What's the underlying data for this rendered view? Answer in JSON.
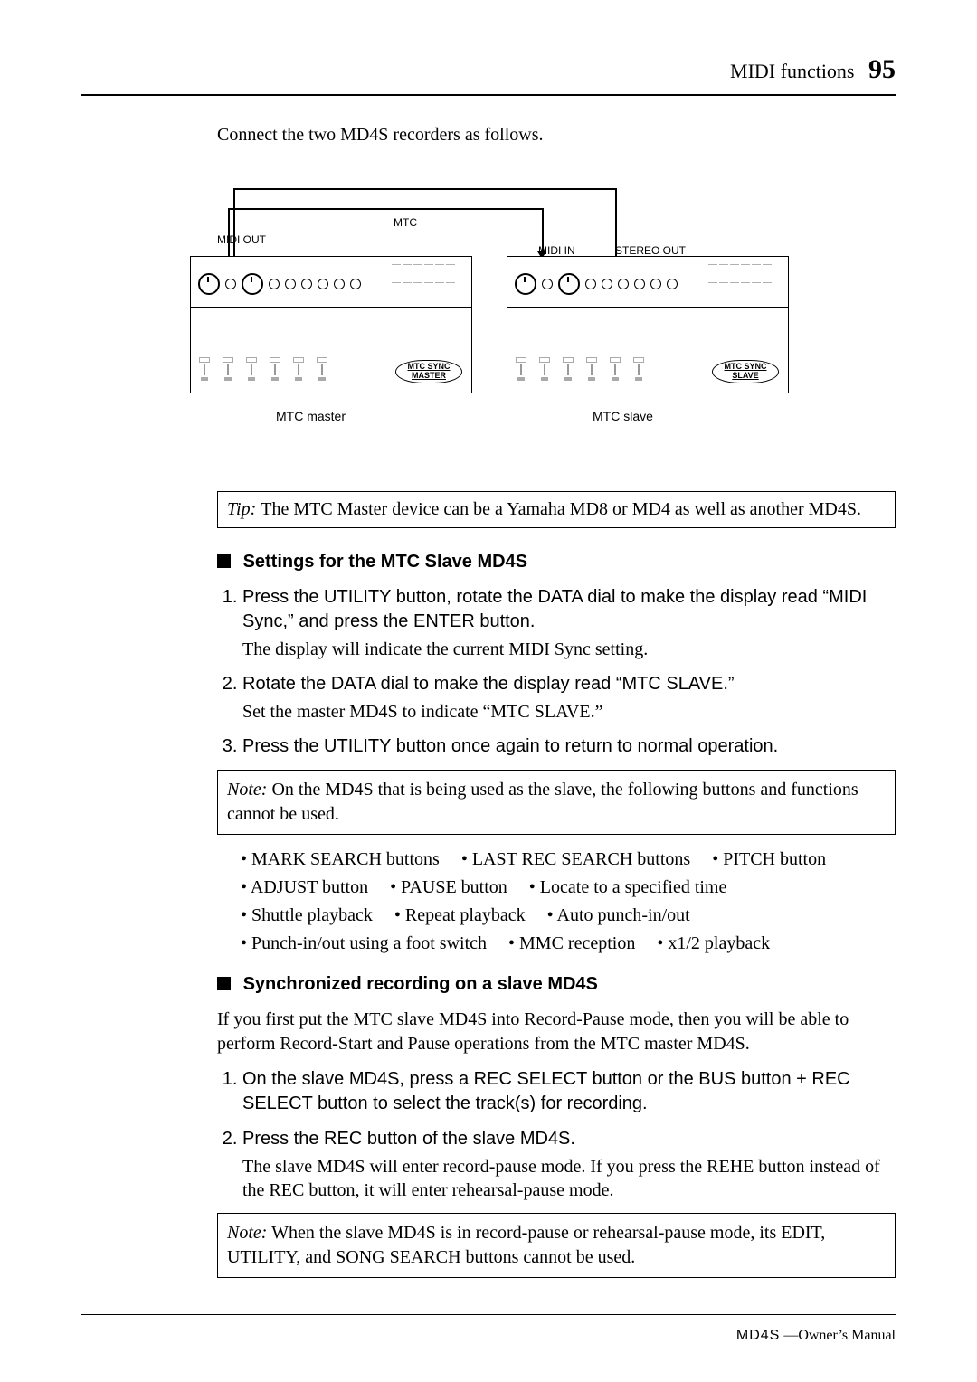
{
  "header": {
    "section": "MIDI functions",
    "page_number": "95"
  },
  "intro_text": "Connect the two MD4S recorders as follows.",
  "diagram": {
    "labels": {
      "midi_out": "MIDI OUT",
      "mtc": "MTC",
      "midi_in": "MIDI IN",
      "stereo_out": "STEREO OUT"
    },
    "badges": {
      "master": "MTC SYNC MASTER",
      "slave": "MTC SYNC SLAVE"
    },
    "captions": {
      "master": "MTC master",
      "slave": "MTC slave"
    }
  },
  "tip": {
    "label": "Tip:",
    "text": "The MTC Master device can be a Yamaha MD8 or MD4 as well as another MD4S."
  },
  "section1": {
    "heading": "Settings for the MTC Slave MD4S",
    "steps": [
      {
        "main": "Press the UTILITY button, rotate the DATA dial to make the display read “MIDI Sync,” and press the ENTER button.",
        "sub": "The display will indicate the current MIDI Sync setting."
      },
      {
        "main": "Rotate the DATA dial to make the display read “MTC SLAVE.”",
        "sub": "Set the master MD4S to indicate “MTC SLAVE.”"
      },
      {
        "main": "Press the UTILITY button once again to return to normal operation.",
        "sub": ""
      }
    ],
    "note": {
      "label": "Note:",
      "text": "On the MD4S that is being used as the slave, the following buttons and functions cannot be used."
    },
    "cannot_rows": [
      [
        "MARK SEARCH buttons",
        "LAST REC SEARCH buttons",
        "PITCH button"
      ],
      [
        "ADJUST button",
        "PAUSE button",
        "Locate to a specified time"
      ],
      [
        "Shuttle playback",
        "Repeat playback",
        "Auto punch-in/out"
      ],
      [
        "Punch-in/out using a foot switch",
        "MMC reception",
        "x1/2 playback"
      ]
    ]
  },
  "section2": {
    "heading": "Synchronized recording on a slave MD4S",
    "intro": "If you first put the MTC slave MD4S into Record-Pause mode, then you will be able to perform Record-Start and Pause operations from the MTC master MD4S.",
    "steps": [
      {
        "main": "On the slave MD4S, press a REC SELECT button or the BUS button + REC SELECT button to select the track(s) for recording.",
        "sub": ""
      },
      {
        "main": "Press the REC button of the slave MD4S.",
        "sub": "The slave MD4S will enter record-pause mode. If you press the REHE button instead of the REC button, it will enter rehearsal-pause mode."
      }
    ],
    "note": {
      "label": "Note:",
      "text": "When the slave MD4S is in record-pause or rehearsal-pause mode, its EDIT, UTILITY, and SONG SEARCH buttons cannot be used."
    }
  },
  "footer": {
    "logo": "MD4S",
    "text": "—Owner’s Manual"
  }
}
